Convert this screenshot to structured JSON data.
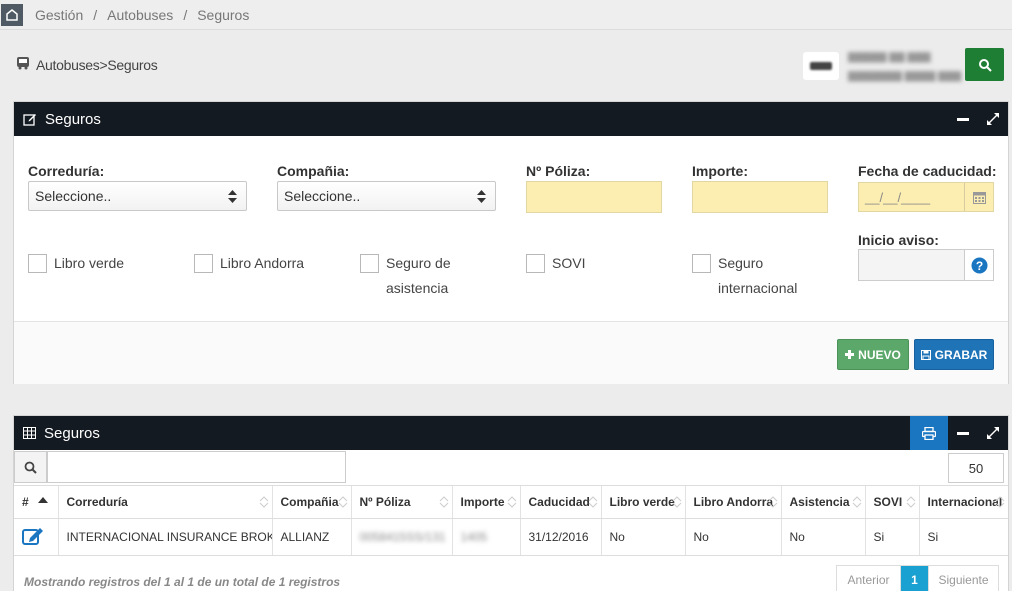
{
  "breadcrumb": {
    "items": [
      "Gestión",
      "Autobuses",
      "Seguros"
    ]
  },
  "subheader": {
    "section": "Autobuses",
    "page": "Seguros"
  },
  "form_panel": {
    "title": "Seguros",
    "labels": {
      "correduria": "Correduría:",
      "compania": "Compañia:",
      "poliza": "Nº Póliza:",
      "importe": "Importe:",
      "fecha_caducidad": "Fecha de caducidad:",
      "inicio_aviso": "Inicio aviso:"
    },
    "correduria_value": "Seleccione..",
    "compania_value": "Seleccione..",
    "fecha_placeholder": "__/__/____",
    "checkboxes": [
      {
        "label": "Libro verde",
        "checked": false
      },
      {
        "label": "Libro Andorra",
        "checked": false
      },
      {
        "label": "Seguro de asistencia",
        "checked": false
      },
      {
        "label": "SOVI",
        "checked": false
      },
      {
        "label": "Seguro internacional",
        "checked": false
      }
    ],
    "buttons": {
      "nuevo": "NUEVO",
      "grabar": "GRABAR"
    }
  },
  "table_panel": {
    "title": "Seguros",
    "search_value": "",
    "page_length": "50",
    "columns": [
      "#",
      "Correduría",
      "Compañia",
      "Nº Póliza",
      "Importe",
      "Caducidad",
      "Libro verde",
      "Libro Andorra",
      "Asistencia",
      "SOVI",
      "Internacional"
    ],
    "rows": [
      {
        "correduria": "INTERNACIONAL INSURANCE BROKER",
        "compania": "ALLIANZ",
        "poliza": "0058415SS/131",
        "importe": "1405",
        "caducidad": "31/12/2016",
        "libro_verde": "No",
        "libro_andorra": "No",
        "asistencia": "No",
        "sovi": "Si",
        "internacional": "Si"
      }
    ],
    "info": "Mostrando registros del 1 al 1 de un total de 1 registros",
    "pagination": {
      "prev": "Anterior",
      "current": "1",
      "next": "Siguiente"
    }
  },
  "colors": {
    "header_dark": "#141a22",
    "green": "#1e7e34",
    "blue": "#1f74b8",
    "yellow_input": "#fbeeb0",
    "page_active": "#1aa0d1"
  }
}
